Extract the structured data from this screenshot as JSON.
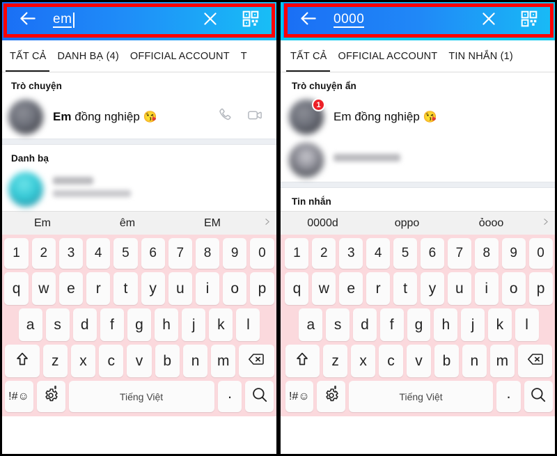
{
  "panels": [
    {
      "id": "left",
      "header": {
        "back_icon": "back-arrow-icon",
        "search_value": "em",
        "close_icon": "close-x-icon",
        "qr_icon": "qr-scan-icon",
        "gradient_start": "#1a6ef5",
        "gradient_end": "#18c0f6",
        "annotation_color": "#ff0000"
      },
      "tabs": [
        {
          "label": "TẤT CẢ",
          "active": true
        },
        {
          "label": "DANH BẠ (4)",
          "active": false
        },
        {
          "label": "OFFICIAL ACCOUNT",
          "active": false
        },
        {
          "label": "T",
          "active": false
        }
      ],
      "sections": [
        {
          "title": "Trò chuyện",
          "rows": [
            {
              "name_bold": "Em",
              "name_rest": " đồng nghiệp",
              "emoji": "😘",
              "avatar": "blurred-person-avatar",
              "badge": null,
              "actions": [
                "phone-call-icon",
                "video-call-icon"
              ],
              "blurred": false
            }
          ]
        },
        {
          "title": "Danh bạ",
          "rows": [
            {
              "name_bold": "",
              "name_rest": "",
              "emoji": "",
              "avatar": "blurred-teal-avatar",
              "badge": null,
              "actions": [],
              "blurred": true
            }
          ]
        }
      ],
      "suggestions": [
        "Em",
        "êm",
        "EM"
      ],
      "suggestion_arrow_icon": "chevron-right-icon",
      "keyboard": {
        "row1": [
          "1",
          "2",
          "3",
          "4",
          "5",
          "6",
          "7",
          "8",
          "9",
          "0"
        ],
        "row2": [
          "q",
          "w",
          "e",
          "r",
          "t",
          "y",
          "u",
          "i",
          "o",
          "p"
        ],
        "row3": [
          "a",
          "s",
          "d",
          "f",
          "g",
          "h",
          "j",
          "k",
          "l"
        ],
        "row4_shift_icon": "shift-up-arrow-icon",
        "row4": [
          "z",
          "x",
          "c",
          "v",
          "b",
          "n",
          "m"
        ],
        "row4_backspace_icon": "backspace-delete-icon",
        "row5_symbols_label": "!#☺",
        "row5_settings_icon": "gear-settings-icon",
        "row5_mic_icon": "microphone-icon",
        "row5_space_label": "Tiếng Việt",
        "row5_period_label": ".",
        "row5_search_icon": "search-magnifier-icon"
      }
    },
    {
      "id": "right",
      "header": {
        "back_icon": "back-arrow-icon",
        "search_value": "0000",
        "close_icon": "close-x-icon",
        "qr_icon": "qr-scan-icon",
        "gradient_start": "#1a6ef5",
        "gradient_end": "#18bdf6",
        "annotation_color": "#ff0000",
        "outer_annotation_color": "#00c8ef"
      },
      "tabs": [
        {
          "label": "TẤT CẢ",
          "active": true
        },
        {
          "label": "OFFICIAL ACCOUNT",
          "active": false
        },
        {
          "label": "TIN NHẮN (1)",
          "active": false
        }
      ],
      "sections": [
        {
          "title": "Trò chuyện ẩn",
          "rows": [
            {
              "name_bold": "",
              "name_rest": "Em đồng nghiệp",
              "emoji": "😘",
              "avatar": "blurred-person-avatar",
              "badge": "1",
              "actions": [],
              "blurred": false
            },
            {
              "name_bold": "",
              "name_rest": "",
              "emoji": "",
              "avatar": "blurred-person-avatar",
              "badge": null,
              "actions": [],
              "blurred": true
            }
          ]
        },
        {
          "title": "Tin nhắn",
          "rows": []
        }
      ],
      "suggestions": [
        "0000d",
        "oppo",
        "ỏooo"
      ],
      "suggestion_arrow_icon": "chevron-right-icon",
      "keyboard": {
        "row1": [
          "1",
          "2",
          "3",
          "4",
          "5",
          "6",
          "7",
          "8",
          "9",
          "0"
        ],
        "row2": [
          "q",
          "w",
          "e",
          "r",
          "t",
          "y",
          "u",
          "i",
          "o",
          "p"
        ],
        "row3": [
          "a",
          "s",
          "d",
          "f",
          "g",
          "h",
          "j",
          "k",
          "l"
        ],
        "row4_shift_icon": "shift-up-arrow-icon",
        "row4": [
          "z",
          "x",
          "c",
          "v",
          "b",
          "n",
          "m"
        ],
        "row4_backspace_icon": "backspace-delete-icon",
        "row5_symbols_label": "!#☺",
        "row5_settings_icon": "gear-settings-icon",
        "row5_mic_icon": "microphone-icon",
        "row5_space_label": "Tiếng Việt",
        "row5_period_label": ".",
        "row5_search_icon": "search-magnifier-icon"
      }
    }
  ],
  "colors": {
    "keyboard_bg": "#fbd9dd",
    "key_bg": "#fbfbfb",
    "badge_red": "#ec2027",
    "annotation_red": "#ff0000",
    "annotation_cyan": "#00c8ef",
    "suggestion_bg": "#f1f1f1"
  }
}
